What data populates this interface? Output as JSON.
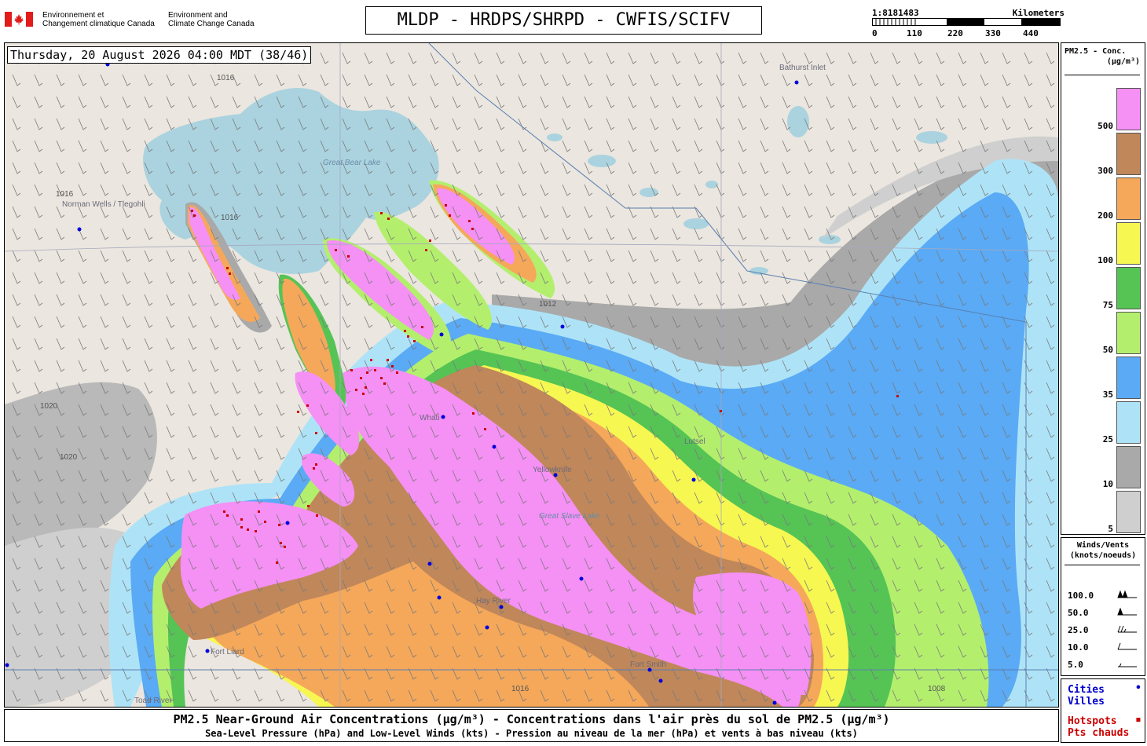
{
  "header": {
    "dept_fr": [
      "Environnement et",
      "Changement climatique Canada"
    ],
    "dept_en": [
      "Environment and",
      "Climate Change Canada"
    ],
    "product_title": "MLDP - HRDPS/SHRPD - CWFIS/SCIFV",
    "scale": {
      "ratio": "1:8181483",
      "unit": "Kilometers",
      "ticks": [
        "0",
        "110",
        "220",
        "330",
        "440"
      ]
    }
  },
  "map": {
    "timestamp": "Thursday, 20 August 2026 04:00 MDT (38/46)",
    "places": [
      {
        "name": "Norman Wells / Tlegohli"
      },
      {
        "name": "Bathurst Inlet"
      },
      {
        "name": "Whati"
      },
      {
        "name": "Yellowknife"
      },
      {
        "name": "Lutsel"
      },
      {
        "name": "Hay River"
      },
      {
        "name": "Fort Smith"
      },
      {
        "name": "Fort Liard"
      },
      {
        "name": "Toad River"
      }
    ],
    "water_labels": [
      "Great Bear Lake",
      "Great Slave Lake"
    ],
    "isobars": [
      "1016",
      "1020",
      "1008",
      "1012"
    ]
  },
  "legend_concentration": {
    "title": "PM2.5 - Conc.",
    "unit": "(µg/m³)",
    "levels": [
      {
        "label": "500",
        "color": "#f590f5"
      },
      {
        "label": "300",
        "color": "#c0875a"
      },
      {
        "label": "200",
        "color": "#f5a85a"
      },
      {
        "label": "100",
        "color": "#f7f752"
      },
      {
        "label": "75",
        "color": "#55c455"
      },
      {
        "label": "50",
        "color": "#b3ef6d"
      },
      {
        "label": "35",
        "color": "#5aaaf5"
      },
      {
        "label": "25",
        "color": "#aee3f7"
      },
      {
        "label": "10",
        "color": "#a9a9a9"
      },
      {
        "label": "5",
        "color": "#cfcfcf"
      }
    ]
  },
  "legend_wind": {
    "title": "Winds/Vents",
    "unit": "(knots/noeuds)",
    "speeds": [
      "100.0",
      "50.0",
      "25.0",
      "10.0",
      "5.0"
    ]
  },
  "legend_points": {
    "cities": [
      "Cities",
      "Villes"
    ],
    "hotspots": [
      "Hotspots",
      "Pts chauds"
    ],
    "city_color": "#0000cc",
    "hotspot_color": "#cc0000"
  },
  "caption": {
    "line1": "PM2.5 Near-Ground Air Concentrations (µg/m³) - Concentrations dans l'air près du sol de PM2.5 (µg/m³)",
    "line2": "Sea-Level Pressure (hPa) and Low-Level Winds (kts) - Pression au niveau de la mer (hPa) et vents à bas niveau (kts)"
  }
}
